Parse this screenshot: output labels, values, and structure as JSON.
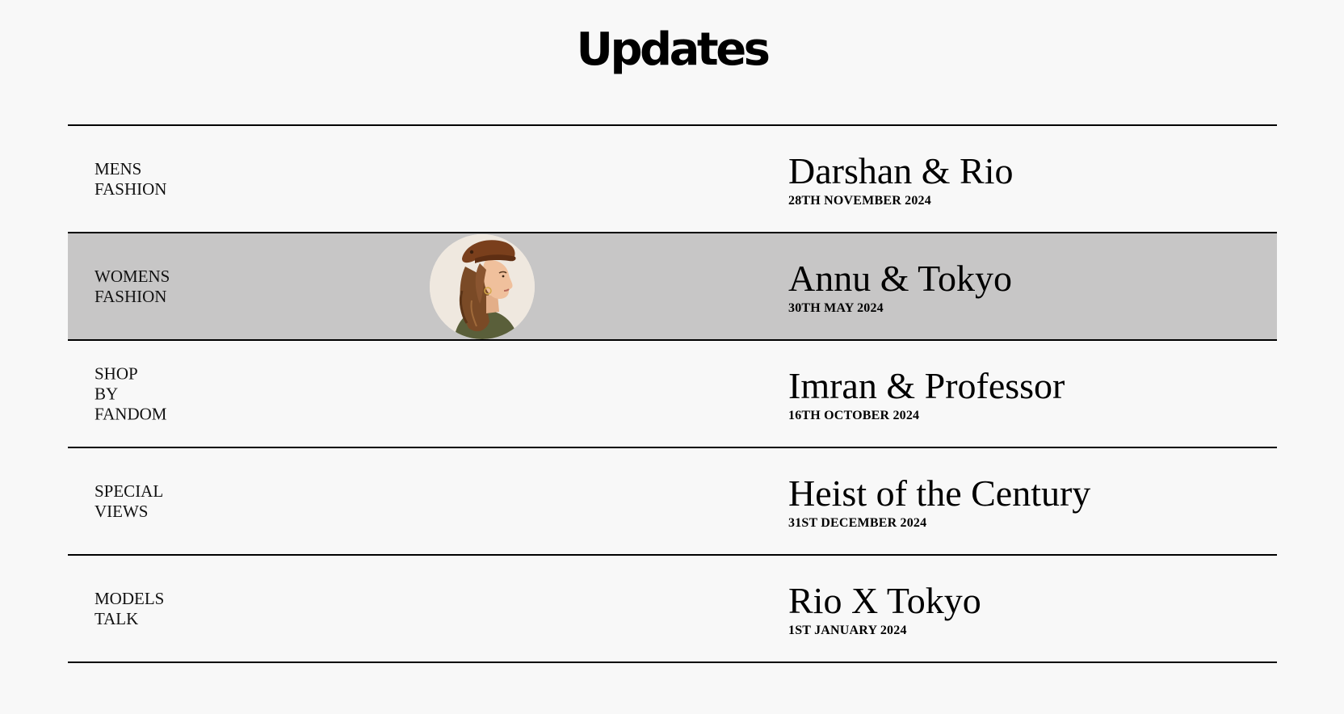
{
  "page": {
    "title": "Updates"
  },
  "updates": [
    {
      "category": [
        "MENS",
        "FASHION"
      ],
      "title": "Darshan & Rio",
      "date": "28TH NOVEMBER 2024",
      "highlighted": false
    },
    {
      "category": [
        "WOMENS",
        "FASHION"
      ],
      "title": "Annu & Tokyo",
      "date": "30TH MAY 2024",
      "highlighted": true,
      "thumbnail": "woman-in-brown-cap-portrait"
    },
    {
      "category": [
        "SHOP",
        "BY",
        "FANDOM"
      ],
      "title": "Imran & Professor",
      "date": "16TH OCTOBER 2024",
      "highlighted": false
    },
    {
      "category": [
        "SPECIAL",
        "VIEWS"
      ],
      "title": "Heist of the Century",
      "date": "31ST DECEMBER 2024",
      "highlighted": false
    },
    {
      "category": [
        "MODELS",
        "TALK"
      ],
      "title": "Rio X Tokyo",
      "date": "1ST JANUARY 2024",
      "highlighted": false
    }
  ],
  "colors": {
    "background": "#f8f8f8",
    "highlight_row": "#c7c6c6",
    "text": "#000000",
    "divider": "#000000"
  }
}
